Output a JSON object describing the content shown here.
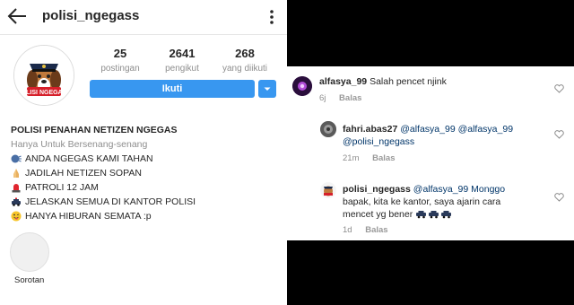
{
  "header": {
    "username": "polisi_ngegass"
  },
  "stats": [
    {
      "value": "25",
      "label": "postingan"
    },
    {
      "value": "2641",
      "label": "pengikut"
    },
    {
      "value": "268",
      "label": "yang diikuti"
    }
  ],
  "avatar_text": "POLISI NGEGASS",
  "follow_label": "Ikuti",
  "bio": {
    "name": "POLISI PENAHAN NETIZEN NGEGAS",
    "category": "Hanya Untuk Bersenang-senang",
    "lines": [
      {
        "icon": "speaking-head-icon",
        "text": "ANDA NGEGAS KAMI TAHAN"
      },
      {
        "icon": "praying-hands-icon",
        "text": "JADILAH NETIZEN SOPAN"
      },
      {
        "icon": "police-light-icon",
        "text": "PATROLI 12 JAM"
      },
      {
        "icon": "police-car-icon",
        "text": "JELASKAN SEMUA DI KANTOR POLISI"
      },
      {
        "icon": "winking-tongue-icon",
        "text": "HANYA HIBURAN SEMATA :p"
      }
    ]
  },
  "highlight_label": "Sorotan",
  "comments": [
    {
      "user": "alfasya_99",
      "text": "Salah pencet njink",
      "time": "6j",
      "reply": "Balas"
    },
    {
      "user": "fahri.abas27",
      "text1": "@alfasya_99 @alfasya_99",
      "text2": "@polisi_ngegass",
      "time": "21m",
      "reply": "Balas"
    },
    {
      "user": "polisi_ngegass",
      "text1": "@alfasya_99 Monggo",
      "text2": "bapak, kita ke kantor, saya ajarin cara",
      "text3": "mencet yg bener",
      "time": "1d",
      "reply": "Balas"
    }
  ],
  "colors": {
    "accent": "#3897f0",
    "muted": "#8e8e8e",
    "text": "#262626"
  }
}
